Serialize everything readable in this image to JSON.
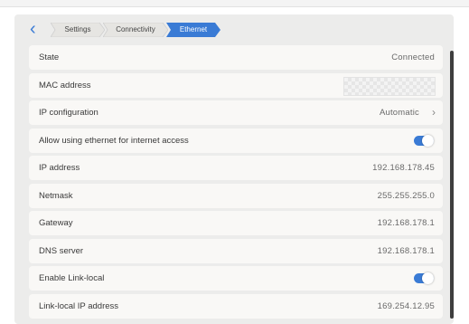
{
  "breadcrumb": {
    "items": [
      "Settings",
      "Connectivity",
      "Ethernet"
    ]
  },
  "rows": {
    "state": {
      "label": "State",
      "value": "Connected"
    },
    "mac": {
      "label": "MAC address"
    },
    "ip_config": {
      "label": "IP configuration",
      "value": "Automatic"
    },
    "allow_internet": {
      "label": "Allow using ethernet for internet access",
      "enabled": true
    },
    "ip_address": {
      "label": "IP address",
      "value": "192.168.178.45"
    },
    "netmask": {
      "label": "Netmask",
      "value": "255.255.255.0"
    },
    "gateway": {
      "label": "Gateway",
      "value": "192.168.178.1"
    },
    "dns": {
      "label": "DNS server",
      "value": "192.168.178.1"
    },
    "link_local": {
      "label": "Enable Link-local",
      "enabled": true
    },
    "link_local_ip": {
      "label": "Link-local IP address",
      "value": "169.254.12.95"
    }
  },
  "icons": {
    "back": "chevron-left-icon",
    "ip_config": "chevron-right-icon"
  },
  "colors": {
    "accent": "#3a7bd5",
    "panel": "#ececeb",
    "row": "#f9f8f6"
  }
}
